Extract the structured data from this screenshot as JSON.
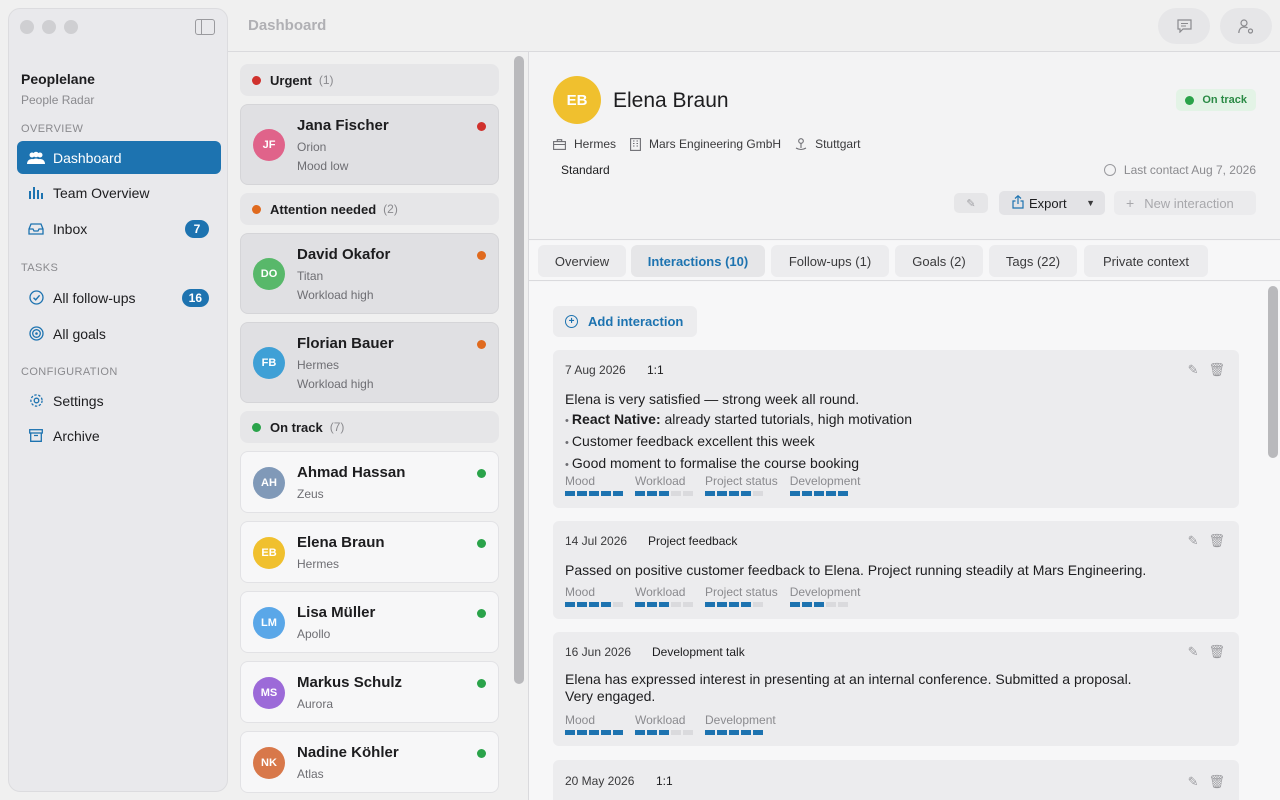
{
  "window": {
    "title": "Dashboard"
  },
  "brand": {
    "name": "Peoplelane",
    "subtitle": "People Radar"
  },
  "sidebar": {
    "sections": [
      {
        "label": "OVERVIEW"
      },
      {
        "label": "TASKS"
      },
      {
        "label": "CONFIGURATION"
      }
    ],
    "items": [
      {
        "label": "Dashboard",
        "icon": "people-icon"
      },
      {
        "label": "Team Overview",
        "icon": "bar-chart-icon"
      },
      {
        "label": "Inbox",
        "icon": "inbox-icon",
        "badge": "7"
      },
      {
        "label": "All follow-ups",
        "icon": "check-circle-icon",
        "badge": "16"
      },
      {
        "label": "All goals",
        "icon": "target-icon"
      },
      {
        "label": "Settings",
        "icon": "gear-icon"
      },
      {
        "label": "Archive",
        "icon": "archive-icon"
      }
    ]
  },
  "groups": [
    {
      "label": "Urgent",
      "count": "(1)",
      "color": "#d0312d"
    },
    {
      "label": "Attention needed",
      "count": "(2)",
      "color": "#e06a1e"
    },
    {
      "label": "On track",
      "count": "(7)",
      "color": "#2aa34a"
    }
  ],
  "people": [
    {
      "initials": "JF",
      "name": "Jana Fischer",
      "team": "Orion",
      "note": "Mood low",
      "color": "#e0638a",
      "status": "#d0312d"
    },
    {
      "initials": "DO",
      "name": "David Okafor",
      "team": "Titan",
      "note": "Workload high",
      "color": "#58b86a",
      "status": "#e06a1e"
    },
    {
      "initials": "FB",
      "name": "Florian Bauer",
      "team": "Hermes",
      "note": "Workload high",
      "color": "#3fa0d6",
      "status": "#e06a1e"
    },
    {
      "initials": "AH",
      "name": "Ahmad Hassan",
      "team": "Zeus",
      "note": "",
      "color": "#8099b8",
      "status": "#2aa34a"
    },
    {
      "initials": "EB",
      "name": "Elena Braun",
      "team": "Hermes",
      "note": "",
      "color": "#f0c02e",
      "status": "#2aa34a"
    },
    {
      "initials": "LM",
      "name": "Lisa Müller",
      "team": "Apollo",
      "note": "",
      "color": "#5aa7e8",
      "status": "#2aa34a"
    },
    {
      "initials": "MS",
      "name": "Markus Schulz",
      "team": "Aurora",
      "note": "",
      "color": "#9c6ad8",
      "status": "#2aa34a"
    },
    {
      "initials": "NK",
      "name": "Nadine Köhler",
      "team": "Atlas",
      "note": "",
      "color": "#d8784a",
      "status": "#2aa34a"
    }
  ],
  "detail": {
    "initials": "EB",
    "name": "Elena Braun",
    "status": "On track",
    "team": "Hermes",
    "company": "Mars Engineering GmbH",
    "location": "Stuttgart",
    "plan": "Standard",
    "last_contact": "Last contact Aug 7, 2026",
    "export_label": "Export",
    "new_label": "New interaction"
  },
  "tabs": [
    {
      "label": "Overview"
    },
    {
      "label": "Interactions (10)"
    },
    {
      "label": "Follow-ups (1)"
    },
    {
      "label": "Goals (2)"
    },
    {
      "label": "Tags (22)"
    },
    {
      "label": "Private context"
    }
  ],
  "add_interaction_label": "Add interaction",
  "interactions": [
    {
      "date": "7 Aug 2026",
      "type": "1:1",
      "text": "Elena is very satisfied — strong week all round.",
      "bullets": [
        {
          "bold": "React Native:",
          "text": " already started tutorials, high motivation"
        },
        {
          "bold": "",
          "text": "Customer feedback excellent this week"
        },
        {
          "bold": "",
          "text": "Good moment to formalise the course booking"
        }
      ],
      "metrics": [
        {
          "label": "Mood",
          "value": 5
        },
        {
          "label": "Workload",
          "value": 3
        },
        {
          "label": "Project status",
          "value": 4
        },
        {
          "label": "Development",
          "value": 5
        }
      ]
    },
    {
      "date": "14 Jul 2026",
      "type": "Project feedback",
      "text": "Passed on positive customer feedback to Elena. Project running steadily at Mars Engineering.",
      "metrics": [
        {
          "label": "Mood",
          "value": 4
        },
        {
          "label": "Workload",
          "value": 3
        },
        {
          "label": "Project status",
          "value": 4
        },
        {
          "label": "Development",
          "value": 3
        }
      ]
    },
    {
      "date": "16 Jun 2026",
      "type": "Development talk",
      "text": "Elena has expressed interest in presenting at an internal conference. Submitted a proposal. Very engaged.",
      "metrics": [
        {
          "label": "Mood",
          "value": 5
        },
        {
          "label": "Workload",
          "value": 3
        },
        {
          "label": "Development",
          "value": 5
        }
      ]
    },
    {
      "date": "20 May 2026",
      "type": "1:1"
    }
  ]
}
